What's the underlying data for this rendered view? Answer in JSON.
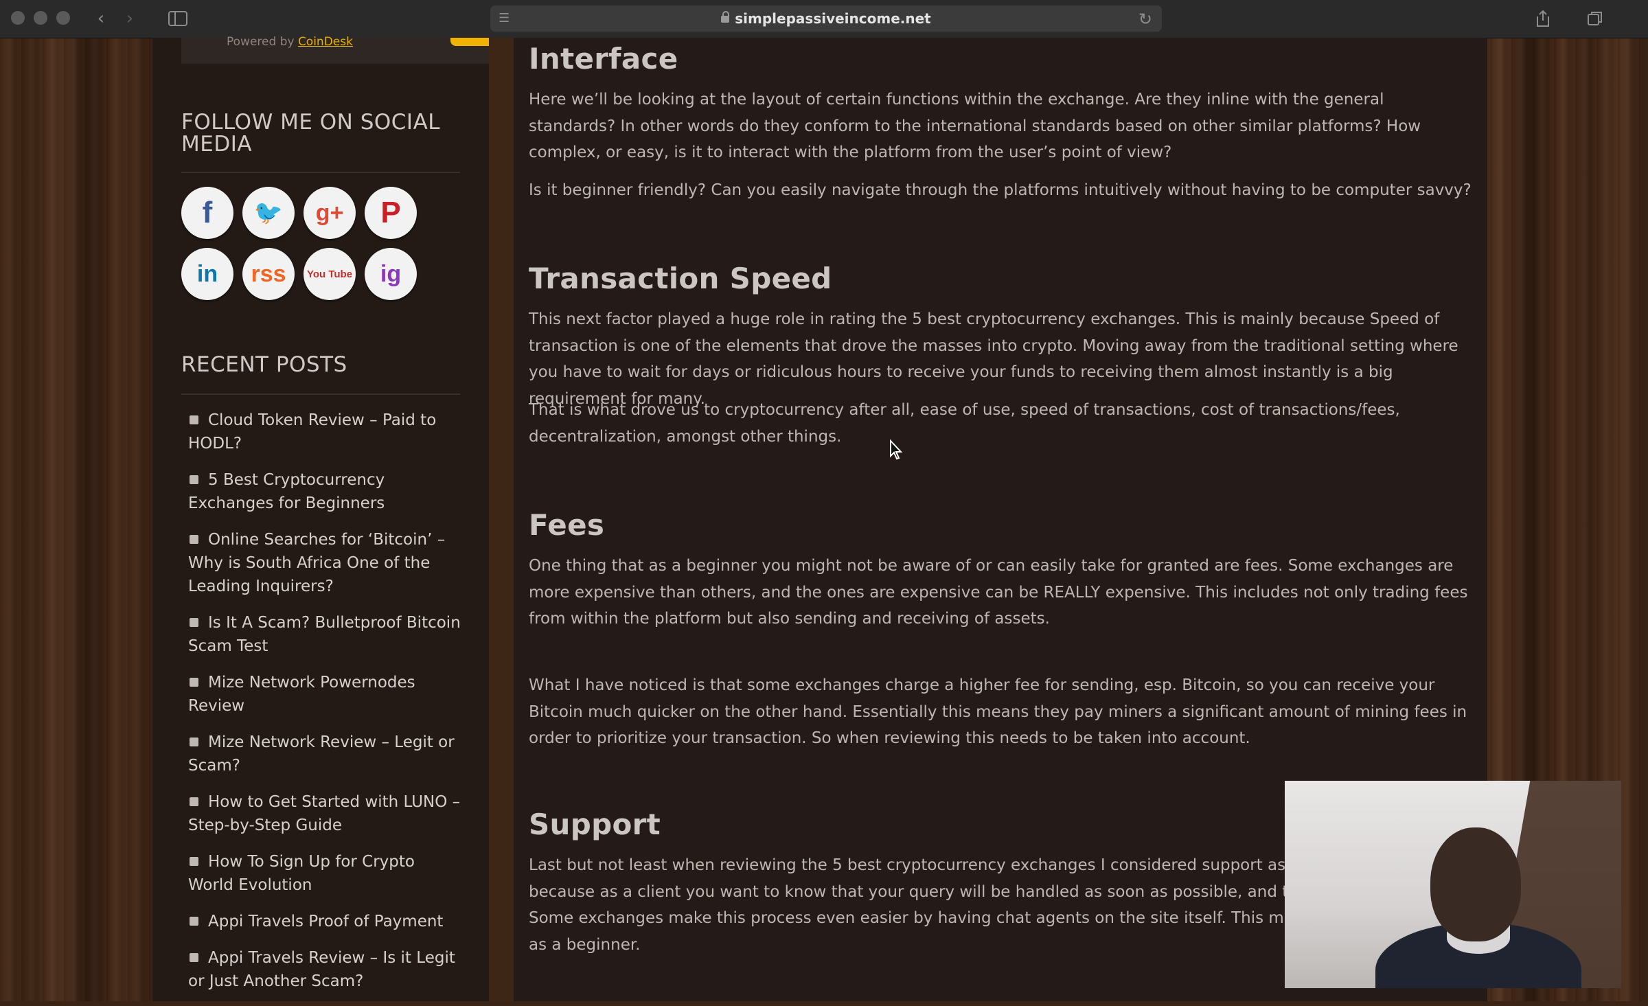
{
  "browser": {
    "url": "simplepassiveincome.net"
  },
  "sidebar": {
    "powered_prefix": "Powered by",
    "powered_link": "CoinDesk",
    "social_heading": "FOLLOW ME ON SOCIAL MEDIA",
    "social_icons": [
      {
        "name": "facebook-icon",
        "glyph": "f",
        "color": "#3b5998"
      },
      {
        "name": "twitter-icon",
        "glyph": "🐦",
        "color": "#1da1f2"
      },
      {
        "name": "google-plus-icon",
        "glyph": "g+",
        "color": "#dd4b39"
      },
      {
        "name": "pinterest-icon",
        "glyph": "P",
        "color": "#cb2027"
      },
      {
        "name": "linkedin-icon",
        "glyph": "in",
        "color": "#0e76a8"
      },
      {
        "name": "rss-icon",
        "glyph": "rss",
        "color": "#f26522"
      },
      {
        "name": "youtube-icon",
        "glyph": "You Tube",
        "color": "#c4302b"
      },
      {
        "name": "instagram-icon",
        "glyph": "ig",
        "color": "#8a3ab9"
      }
    ],
    "recent_heading": "RECENT POSTS",
    "recent_posts": [
      "Cloud Token Review – Paid to HODL?",
      "5 Best Cryptocurrency Exchanges for Beginners",
      "Online Searches for ‘Bitcoin’ – Why is South Africa One of the Leading Inquirers?",
      "Is It A Scam? Bulletproof Bitcoin Scam Test",
      "Mize Network Powernodes Review",
      "Mize Network Review – Legit or Scam?",
      "How to Get Started with LUNO – Step-by-Step Guide",
      "How To Sign Up for Crypto World Evolution",
      "Appi Travels Proof of Payment",
      "Appi Travels Review – Is it Legit or Just Another Scam?"
    ]
  },
  "article": {
    "interface_heading": "Interface",
    "interface_p1": "Here we’ll be looking at the layout of certain functions within the exchange. Are they inline with the general standards? In other words do they conform to the international standards based on other similar platforms? How complex, or easy, is it to interact with the platform from the user’s point of view?",
    "interface_p2": "Is it beginner friendly? Can you easily navigate through the platforms intuitively without having to be computer savvy?",
    "speed_heading": "Transaction Speed",
    "speed_p1": "This next factor played a huge role in rating the 5 best cryptocurrency exchanges. This is mainly because Speed of transaction is one of the elements that drove the masses into crypto. Moving away from the traditional setting where you have to wait for days or ridiculous hours to receive your funds to receiving them almost instantly is a big requirement for many.",
    "speed_p2": "That is what drove us to cryptocurrency after all, ease of use, speed of transactions, cost of transactions/fees, decentralization, amongst other things.",
    "fees_heading": "Fees",
    "fees_p1": "One thing that as a beginner you might not be aware of or can easily take for granted are fees. Some exchanges are more expensive than others, and the ones are expensive can be REALLY expensive. This includes not only trading fees from within the platform but also sending and receiving of assets.",
    "fees_p2": "What I have noticed is that some exchanges charge a higher fee for sending, esp. Bitcoin, so you can receive your Bitcoin much quicker on the other hand. Essentially this means they pay miners a significant amount of mining fees in order to prioritize your transaction. So when reviewing this needs to be taken into account.",
    "support_heading": "Support",
    "support_l1": "Last but not least when reviewing the 5 best cryptocurrency exchanges I considered support as well. T",
    "support_l2": "because as a client you want to know that your query will be handled as soon as possible, and that yo",
    "support_l3": "Some exchanges make this process even easier by having chat agents on the site itself. This makes yo",
    "support_l4": "as a beginner."
  }
}
